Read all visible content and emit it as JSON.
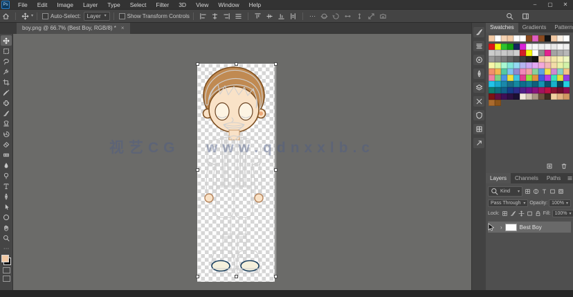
{
  "window": {
    "logo": "Ps",
    "controls": [
      {
        "name": "minimize",
        "glyph": "–"
      },
      {
        "name": "restore",
        "glyph": "▢"
      },
      {
        "name": "close",
        "glyph": "✕"
      }
    ]
  },
  "menu": {
    "items": [
      "File",
      "Edit",
      "Image",
      "Layer",
      "Type",
      "Select",
      "Filter",
      "3D",
      "View",
      "Window",
      "Help"
    ]
  },
  "options_bar": {
    "home_icon": "home",
    "tool_icon": "move",
    "auto_select_label": "Auto-Select:",
    "auto_select_value": "Layer",
    "show_transform_label": "Show Transform Controls",
    "align_icons": [
      "align-left",
      "align-center-h",
      "align-right",
      "align-lines"
    ],
    "distribute_icons": [
      "dist-top",
      "dist-middle",
      "dist-bottom",
      "dist-gap"
    ],
    "more_icon": "ellipsis",
    "threed_icons": [
      "orbit-3d",
      "roll-3d",
      "drag-3d",
      "slide-3d",
      "scale-3d",
      "camera-3d"
    ],
    "right_icons": [
      "search",
      "workspace"
    ]
  },
  "document_tab": {
    "title": "boy.png @ 66.7% (Best Boy, RGB/8) *",
    "close_glyph": "×"
  },
  "toolbar": {
    "tools": [
      {
        "name": "move-tool",
        "icon": "move",
        "selected": true
      },
      {
        "name": "marquee-tool",
        "icon": "marquee"
      },
      {
        "name": "lasso-tool",
        "icon": "lasso"
      },
      {
        "name": "quick-selection-tool",
        "icon": "quickselect"
      },
      {
        "name": "crop-tool",
        "icon": "crop"
      },
      {
        "name": "eyedropper-tool",
        "icon": "eyedropper"
      },
      {
        "name": "healing-brush-tool",
        "icon": "healing"
      },
      {
        "name": "brush-tool",
        "icon": "brush"
      },
      {
        "name": "clone-stamp-tool",
        "icon": "stamp"
      },
      {
        "name": "history-brush-tool",
        "icon": "history"
      },
      {
        "name": "eraser-tool",
        "icon": "eraser"
      },
      {
        "name": "gradient-tool",
        "icon": "gradient"
      },
      {
        "name": "blur-tool",
        "icon": "blur"
      },
      {
        "name": "dodge-tool",
        "icon": "dodge"
      },
      {
        "name": "type-tool",
        "icon": "type"
      },
      {
        "name": "pen-tool",
        "icon": "pen"
      },
      {
        "name": "path-selection-tool",
        "icon": "pathselect"
      },
      {
        "name": "shape-tool",
        "icon": "shape"
      },
      {
        "name": "hand-tool",
        "icon": "hand"
      },
      {
        "name": "zoom-tool",
        "icon": "zoom"
      },
      {
        "name": "edit-toolbar",
        "icon": "ellipsis"
      }
    ],
    "fg_color": "#f2c9a4",
    "bg_color": "#0a0a0a"
  },
  "canvas": {
    "watermark": "视艺CG   www.qdnxxlb.c"
  },
  "right_dock": {
    "icons": [
      {
        "name": "brushes-panel",
        "icon": "dock-brush"
      },
      {
        "name": "brush-settings-panel",
        "icon": "dock-lines"
      },
      {
        "name": "clone-source-panel",
        "icon": "dock-target"
      },
      {
        "name": "tool-presets-panel",
        "icon": "dock-pen"
      },
      {
        "name": "character-panel",
        "icon": "dock-layers"
      },
      {
        "name": "properties-panel",
        "icon": "dock-x"
      },
      {
        "name": "libraries-panel",
        "icon": "dock-shield"
      },
      {
        "name": "info-panel",
        "icon": "dock-grid"
      },
      {
        "name": "export-panel",
        "icon": "dock-arrow"
      }
    ]
  },
  "panels": {
    "swatches": {
      "tabs": [
        {
          "label": "Swatches",
          "active": true
        },
        {
          "label": "Gradients"
        },
        {
          "label": "Patterns"
        }
      ],
      "menu_icon": "hamburger",
      "rows": [
        [
          "#f2c9a4",
          "#ffffff",
          "#f5d3b3",
          "#f2c9a4",
          "#fdfdfd",
          "#ffffff",
          "#8a4a1f",
          "#e05ec2",
          "#8a4a1f",
          "#141414",
          "#f2c9a4",
          "#faf2e8",
          "#ffffff"
        ],
        [
          "#e01515",
          "#f2f20c",
          "#2ec22e",
          "#12a012",
          "#14265e",
          "#d921d9",
          "#f2f2f2",
          "#f7f7f7",
          "#ededed",
          "#f2f2f2",
          "#e8e8e8",
          "#f5f5f5",
          "#efefef"
        ],
        [
          "#cccccc",
          "#c6c6c6",
          "#c9c9c9",
          "#c2c2c2",
          "#cfcfcf",
          "#d31d28",
          "#f7f70e",
          "#fcfcfc",
          "#8f8f8f",
          "#e2238f",
          "#a3a3a3",
          "#adadad",
          "#b8b8b8"
        ],
        [
          "#999999",
          "#8a8a8a",
          "#7a7a7a",
          "#666666",
          "#525252",
          "#3d3d3d",
          "#292929",
          "#141414",
          "#f5c9a0",
          "#f8d6b3",
          "#f2e6a8",
          "#f7f2b8",
          "#eef7c2"
        ],
        [
          "#f7f7a8",
          "#dcf7a8",
          "#a8f7d2",
          "#82e8da",
          "#93daf2",
          "#b5b5f0",
          "#cca8f2",
          "#e2a8f2",
          "#f2a8dc",
          "#f2b5b5",
          "#f2dca8",
          "#e8f2a8",
          "#d2f2a8"
        ],
        [
          "#f28f6b",
          "#f2b54f",
          "#54c9a2",
          "#80c2f0",
          "#9188d1",
          "#f088ba",
          "#f2a2a2",
          "#88d19d",
          "#5da2e2",
          "#f2e24f",
          "#d188d1",
          "#88d1c4",
          "#f2c488"
        ],
        [
          "#f080a2",
          "#80d280",
          "#4a95e2",
          "#f2e23e",
          "#3ec4e2",
          "#e23e91",
          "#91e23e",
          "#e2923e",
          "#3e5de2",
          "#ba3ee2",
          "#3ee2ba",
          "#e2e23e",
          "#923ee2"
        ],
        [
          "#21c4e8",
          "#18aacb",
          "#1a88aa",
          "#1a6d88",
          "#1489a0",
          "#0e6d8c",
          "#127c97",
          "#0f5f7c",
          "#1595b2",
          "#0d516d",
          "#18b2cb",
          "#0a4459",
          "#23d1e2"
        ],
        [
          "#0f7c6d",
          "#0e6d7c",
          "#116088",
          "#153e88",
          "#2d2d88",
          "#4f2188",
          "#6d1588",
          "#88157c",
          "#a21360",
          "#ba1244",
          "#881532",
          "#6d102d",
          "#8c0f4f"
        ],
        [
          "#7c1212",
          "#601044",
          "#3e1058",
          "#2d1044",
          "#1a1032",
          "#f2e8dc",
          "#d1c4b2",
          "#aa9784",
          "#6d513e",
          "#3e2d21",
          "#f2d1a0",
          "#e2b180",
          "#d19762"
        ],
        [
          "#aa6a2d",
          "#8c541a"
        ]
      ],
      "footer_icons": [
        "new-swatch",
        "delete-swatch"
      ]
    },
    "layers": {
      "tabs": [
        {
          "label": "Layers",
          "active": true
        },
        {
          "label": "Channels"
        },
        {
          "label": "Paths"
        }
      ],
      "filter": {
        "search_icon": "search",
        "kind_label": "Kind",
        "icons": [
          "pixel-filter",
          "adjustment-filter",
          "type-filter",
          "shape-filter",
          "smart-filter"
        ]
      },
      "blend_mode": "Pass Through",
      "opacity_label": "Opacity:",
      "opacity_value": "100%",
      "lock_label": "Lock:",
      "lock_icons": [
        "lock-transparent",
        "lock-pixels",
        "lock-position",
        "lock-artboard",
        "lock-all"
      ],
      "fill_label": "Fill:",
      "fill_value": "100%",
      "rows": [
        {
          "name": "Best Boy",
          "expand": "›"
        }
      ]
    }
  }
}
